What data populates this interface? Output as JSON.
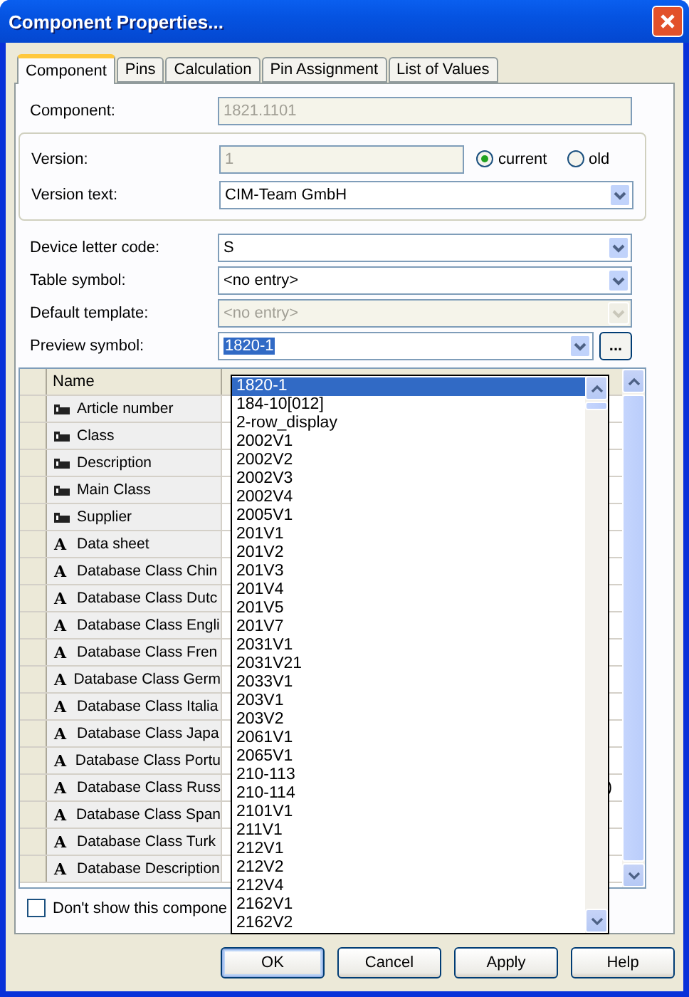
{
  "window": {
    "title": "Component Properties..."
  },
  "tabs": [
    {
      "label": "Component",
      "selected": true
    },
    {
      "label": "Pins",
      "selected": false
    },
    {
      "label": "Calculation",
      "selected": false
    },
    {
      "label": "Pin Assignment",
      "selected": false
    },
    {
      "label": "List of Values",
      "selected": false
    }
  ],
  "component": {
    "label": "Component:",
    "value": "1821.1101",
    "disabled": true
  },
  "version": {
    "label": "Version:",
    "value": "1",
    "disabled": true,
    "radios": [
      {
        "label": "current",
        "selected": true
      },
      {
        "label": "old",
        "selected": false
      }
    ]
  },
  "version_text": {
    "label": "Version text:",
    "value": "CIM-Team GmbH",
    "disabled": false
  },
  "combos": [
    {
      "label": "Device letter code:",
      "value": "S",
      "disabled": false
    },
    {
      "label": "Table symbol:",
      "value": "<no entry>",
      "disabled": false
    },
    {
      "label": "Default template:",
      "value": "<no entry>",
      "disabled": true
    }
  ],
  "preview_symbol": {
    "label": "Preview symbol:",
    "value": "1820-1",
    "button": "...",
    "expanded": true,
    "options": [
      {
        "label": "1820-1",
        "selected": true
      },
      {
        "label": "184-10[012]",
        "selected": false
      },
      {
        "label": "2-row_display",
        "selected": false
      },
      {
        "label": "2002V1",
        "selected": false
      },
      {
        "label": "2002V2",
        "selected": false
      },
      {
        "label": "2002V3",
        "selected": false
      },
      {
        "label": "2002V4",
        "selected": false
      },
      {
        "label": "2005V1",
        "selected": false
      },
      {
        "label": "201V1",
        "selected": false
      },
      {
        "label": "201V2",
        "selected": false
      },
      {
        "label": "201V3",
        "selected": false
      },
      {
        "label": "201V4",
        "selected": false
      },
      {
        "label": "201V5",
        "selected": false
      },
      {
        "label": "201V7",
        "selected": false
      },
      {
        "label": "2031V1",
        "selected": false
      },
      {
        "label": "2031V21",
        "selected": false
      },
      {
        "label": "2033V1",
        "selected": false
      },
      {
        "label": "203V1",
        "selected": false
      },
      {
        "label": "203V2",
        "selected": false
      },
      {
        "label": "2061V1",
        "selected": false
      },
      {
        "label": "2065V1",
        "selected": false
      },
      {
        "label": "210-113",
        "selected": false
      },
      {
        "label": "210-114",
        "selected": false
      },
      {
        "label": "2101V1",
        "selected": false
      },
      {
        "label": "211V1",
        "selected": false
      },
      {
        "label": "212V1",
        "selected": false
      },
      {
        "label": "212V2",
        "selected": false
      },
      {
        "label": "212V4",
        "selected": false
      },
      {
        "label": "2162V1",
        "selected": false
      },
      {
        "label": "2162V2",
        "selected": false
      }
    ]
  },
  "table": {
    "columns": [
      "Name"
    ],
    "rows": [
      {
        "kind": "field",
        "name": "Article number"
      },
      {
        "kind": "field",
        "name": "Class"
      },
      {
        "kind": "field",
        "name": "Description"
      },
      {
        "kind": "field",
        "name": "Main Class"
      },
      {
        "kind": "field",
        "name": "Supplier"
      },
      {
        "kind": "text",
        "glyph": "A",
        "name": "Data sheet"
      },
      {
        "kind": "text",
        "glyph": "A",
        "name": "Database Class Chin"
      },
      {
        "kind": "text",
        "glyph": "A",
        "name": "Database Class Dutc"
      },
      {
        "kind": "text",
        "glyph": "A",
        "name": "Database Class Engli"
      },
      {
        "kind": "text",
        "glyph": "A",
        "name": "Database Class Fren"
      },
      {
        "kind": "text",
        "glyph": "A",
        "name": "Database Class Germ"
      },
      {
        "kind": "text",
        "glyph": "A",
        "name": "Database Class Italia"
      },
      {
        "kind": "text",
        "glyph": "A",
        "name": "Database Class Japa"
      },
      {
        "kind": "text",
        "glyph": "A",
        "name": "Database Class Portu"
      },
      {
        "kind": "text",
        "glyph": "A",
        "name": "Database Class Russ",
        "column_2": ")"
      },
      {
        "kind": "text",
        "glyph": "A",
        "name": "Database Class Span"
      },
      {
        "kind": "text",
        "glyph": "A",
        "name": "Database Class Turk"
      },
      {
        "kind": "text",
        "glyph": "A",
        "name": "Database Description"
      }
    ]
  },
  "checkbox": {
    "label": "Don't show this compone",
    "checked": false
  },
  "buttons": [
    {
      "label": "OK",
      "default": true
    },
    {
      "label": "Cancel",
      "default": false
    },
    {
      "label": "Apply",
      "default": false
    },
    {
      "label": "Help",
      "default": false
    }
  ]
}
